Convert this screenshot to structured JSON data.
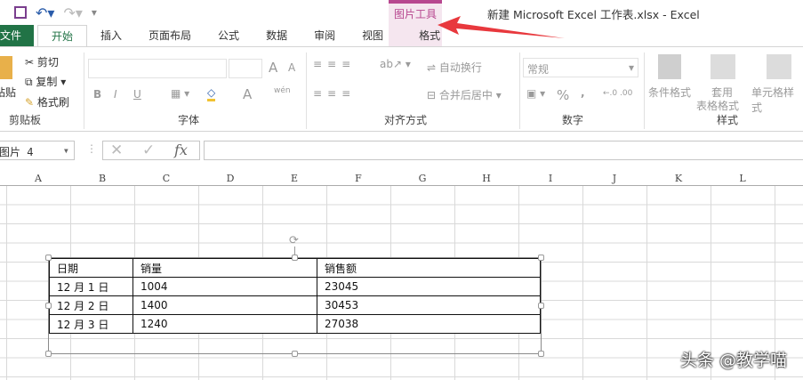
{
  "window": {
    "title": "新建 Microsoft Excel 工作表.xlsx - Excel",
    "context_tab_group": "图片工具"
  },
  "tabs": [
    {
      "label": "文件"
    },
    {
      "label": "开始"
    },
    {
      "label": "插入"
    },
    {
      "label": "页面布局"
    },
    {
      "label": "公式"
    },
    {
      "label": "数据"
    },
    {
      "label": "审阅"
    },
    {
      "label": "视图"
    },
    {
      "label": "格式"
    }
  ],
  "ribbon": {
    "clipboard": {
      "paste": "粘贴",
      "cut": "剪切",
      "copy": "复制",
      "format_painter": "格式刷",
      "label": "剪贴板"
    },
    "font": {
      "label": "字体",
      "bold": "B",
      "italic": "I",
      "underline": "U",
      "font_color": "A",
      "grow": "A",
      "shrink": "A",
      "phonetic": "wén"
    },
    "alignment": {
      "wrap": "自动换行",
      "merge": "合并后居中",
      "label": "对齐方式"
    },
    "number": {
      "format": "常规",
      "percent": "%",
      "comma": ",",
      "label": "数字"
    },
    "styles": {
      "conditional": "条件格式",
      "table_format_1": "套用",
      "table_format_2": "表格格式",
      "cell_styles": "单元格样式",
      "label": "样式"
    }
  },
  "name_box": "图片 4",
  "formula_bar": {
    "fx": "fx",
    "value": ""
  },
  "columns": [
    "A",
    "B",
    "C",
    "D",
    "E",
    "F",
    "G",
    "H",
    "I",
    "J",
    "K",
    "L"
  ],
  "table": {
    "headers": [
      "日期",
      "销量",
      "销售额"
    ],
    "rows": [
      [
        "12 月 1 日",
        "1004",
        "23045"
      ],
      [
        "12 月 2 日",
        "1400",
        "30453"
      ],
      [
        "12 月 3 日",
        "1240",
        "27038"
      ]
    ]
  },
  "watermark": "头条 @教学喵",
  "colors": {
    "file_tab": "#217346",
    "context": "#b7478f",
    "arrow": "#e8383d"
  }
}
